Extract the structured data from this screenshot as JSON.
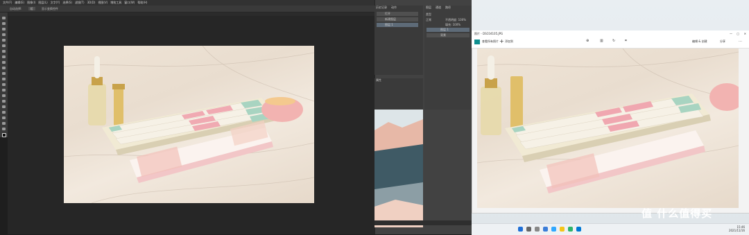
{
  "photoshop": {
    "menu": [
      "文件(F)",
      "编辑(E)",
      "图像(I)",
      "图层(L)",
      "文字(Y)",
      "选择(S)",
      "滤镜(T)",
      "3D(D)",
      "视图(V)",
      "增效工具",
      "窗口(W)",
      "帮助(H)"
    ],
    "options": {
      "auto_select": "自动选择:",
      "group": "组",
      "transform": "显示变换控件"
    },
    "panels": {
      "history_tabs": [
        "历史记录",
        "动作"
      ],
      "history_items": [
        "打开",
        "新建图层",
        "图层 1"
      ],
      "properties_tab": "属性",
      "layers_tabs": [
        "图层",
        "通道",
        "路径"
      ],
      "layers_kind": "类型",
      "blend_mode": "正常",
      "opacity": "不透明度: 100%",
      "fill": "填充: 100%",
      "layer_names": [
        "图层 1",
        "背景"
      ]
    }
  },
  "viewer": {
    "title": "照片 - DSC04105.JPG",
    "edit_button": "查看所有照片",
    "add_button": "添加到",
    "edit_image": "编辑 & 创建",
    "share": "分享"
  },
  "watermark": "值 什么值得买",
  "taskbar": {
    "time": "15:46",
    "date": "2021/11/16"
  },
  "colors": {
    "ps_dark": "#262626",
    "ps_panel": "#424242",
    "viewer_accent": "#0067c0"
  }
}
